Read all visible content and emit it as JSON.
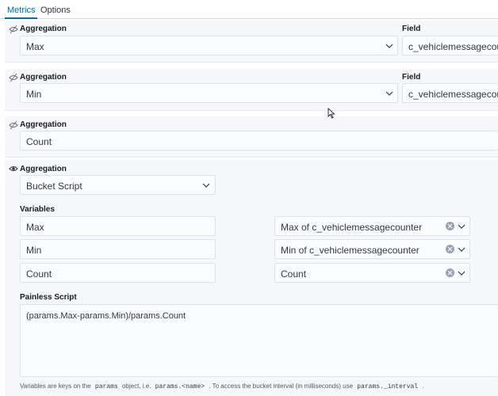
{
  "tabs": {
    "metrics": "Metrics",
    "options": "Options"
  },
  "agg1": {
    "label": "Aggregation",
    "value": "Max",
    "field_label": "Field",
    "field_value": "c_vehiclemessagecounter"
  },
  "agg2": {
    "label": "Aggregation",
    "value": "Min",
    "field_label": "Field",
    "field_value": "c_vehiclemessagecounter"
  },
  "agg3": {
    "label": "Aggregation",
    "value": "Count"
  },
  "agg4": {
    "label": "Aggregation",
    "value": "Bucket Script",
    "variables_label": "Variables",
    "variables": [
      {
        "name": "Max",
        "metric": "Max of c_vehiclemessagecounter"
      },
      {
        "name": "Min",
        "metric": "Min of c_vehiclemessagecounter"
      },
      {
        "name": "Count",
        "metric": "Count"
      }
    ],
    "script_label": "Painless Script",
    "script": "(params.Max-params.Min)/params.Count",
    "help": {
      "t1": "Variables are keys on the",
      "c1": "params",
      "t2": "object, i.e.",
      "c2": "params.<name>",
      "t3": ". To access the bucket interval (in milliseconds) use",
      "c3": "params._interval",
      "t4": "."
    }
  },
  "icons": {
    "hidden": "eye-closed-icon",
    "visible": "eye-icon",
    "chevron": "chevron-down-icon",
    "clear": "clear-icon"
  },
  "colors": {
    "accent": "#006bb4",
    "panel": "#f5f7fa"
  }
}
